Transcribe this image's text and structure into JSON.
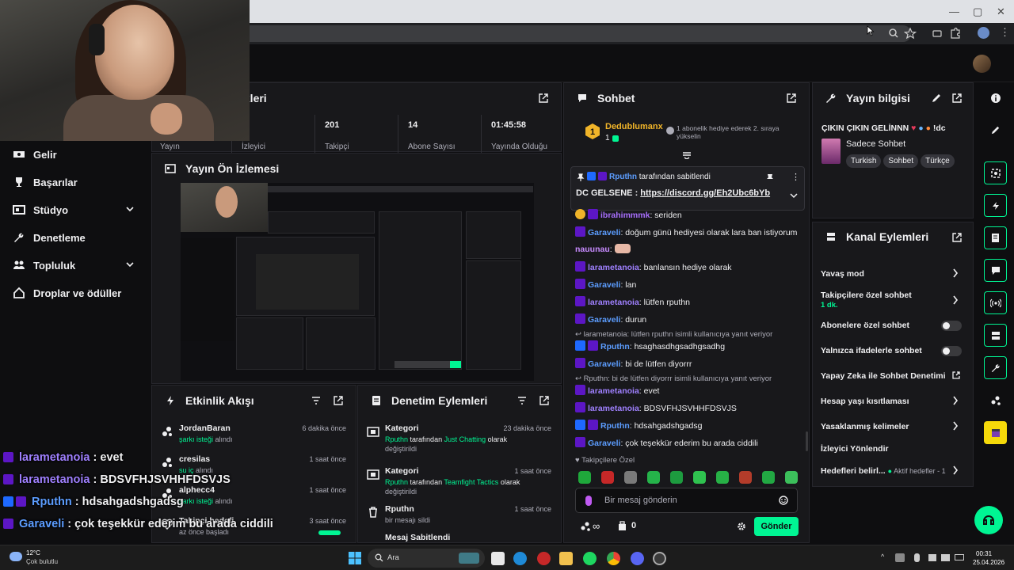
{
  "chat": {
    "title": "Sohbet",
    "top_user": "Dedublumanx",
    "top_user_count": "1",
    "top_note": "1 abonelik hediye ederek 2. sıraya yükselin",
    "pinned_by_user": "Rputhn",
    "pinned_by_suffix": "tarafından sabitlendi",
    "pinned_text": "DC GELSENE :",
    "pinned_link": "https://discord.gg/Eh2Ubc6bYb",
    "messages": [
      {
        "user": "ibrahimmmk",
        "text": "seriden",
        "color": "#a970ff",
        "badge": "gold"
      },
      {
        "user": "Garaveli",
        "text": "doğum günü hediyesi olarak lara ban istiyorum",
        "color": "#5c9dff",
        "badge": "star"
      },
      {
        "user": "nauunau",
        "text": "",
        "color": "#c88bff",
        "badge": "none"
      },
      {
        "user": "larametanoia",
        "text": "banlansın hediye olarak",
        "color": "#9f80ff",
        "badge": "star"
      },
      {
        "user": "Garaveli",
        "text": "lan",
        "color": "#5c9dff",
        "badge": "star"
      },
      {
        "user": "larametanoia",
        "text": "lütfen rputhn",
        "color": "#9f80ff",
        "badge": "star"
      },
      {
        "user": "Garaveli",
        "text": "durun",
        "color": "#5c9dff",
        "badge": "star"
      },
      {
        "user": "Rputhn",
        "text": "hsaghasdhgsadhgsadhg",
        "color": "#5c9dff",
        "badge": "blue"
      },
      {
        "user": "Garaveli",
        "text": "bi de lütfen diyorrr",
        "color": "#5c9dff",
        "badge": "star"
      },
      {
        "user": "larametanoia",
        "text": "evet",
        "color": "#9f80ff",
        "badge": "star"
      },
      {
        "user": "larametanoia",
        "text": "BDSVFHJSVHHFDSVJS",
        "color": "#9f80ff",
        "badge": "star"
      },
      {
        "user": "Rputhn",
        "text": "hdsahgadshgadsg",
        "color": "#5c9dff",
        "badge": "blue"
      },
      {
        "user": "Garaveli",
        "text": "çok teşekkür ederim bu arada ciddili",
        "color": "#5c9dff",
        "badge": "star"
      }
    ],
    "reply1": "↩ larametanoia: lütfen rputhn isimli kullanıcıya yanıt veriyor",
    "reply2": "↩ Rputhn: bi de lütfen diyorrr isimli kullanıcıya yanıt veriyor",
    "followers_only": "Takipçilere Özel",
    "input_placeholder": "Bir mesaj gönderin",
    "points": "0",
    "send_label": "Gönder"
  },
  "stats": {
    "title_partial": "ikleri",
    "values": [
      "201",
      "14",
      "01:45:58"
    ],
    "labels": [
      "Yayın",
      "İzleyici",
      "Takipçi",
      "Abone Sayısı",
      "Yayında Olduğu"
    ]
  },
  "preview": {
    "title": "Yayın Ön İzlemesi"
  },
  "nav": {
    "items": [
      {
        "label": "Gelir",
        "icon": "dollar-icon"
      },
      {
        "label": "Başarılar",
        "icon": "trophy-icon"
      },
      {
        "label": "Stüdyo",
        "icon": "studio-icon"
      },
      {
        "label": "Denetleme",
        "icon": "wrench-icon"
      },
      {
        "label": "Topluluk",
        "icon": "community-icon"
      },
      {
        "label": "Droplar ve ödüller",
        "icon": "drops-icon"
      }
    ]
  },
  "activity": {
    "title": "Etkinlik Akışı",
    "items": [
      {
        "name": "JordanBaran",
        "sub_hl": "şarkı isteği",
        "sub": "alındı",
        "time": "6 dakika önce"
      },
      {
        "name": "cresilas",
        "sub_hl": "su iç",
        "sub": "alındı",
        "time": "1 saat önce"
      },
      {
        "name": "alphecc4",
        "sub_hl": "şarkı isteği",
        "sub": "alındı",
        "time": "1 saat önce"
      },
      {
        "name": "Takipçi hedefi",
        "sub_hl": "",
        "sub": "az önce başladı",
        "time": "3 saat önce"
      }
    ]
  },
  "modactions": {
    "title": "Denetim Eylemleri",
    "items": [
      {
        "title": "Kategori",
        "user": "Rputhn",
        "mid": "tarafından",
        "hl": "Just Chatting",
        "rest": "olarak",
        "end": "değiştirildi",
        "time": "23 dakika önce"
      },
      {
        "title": "Kategori",
        "user": "Rputhn",
        "mid": "tarafından",
        "hl": "Teamfight Tactics",
        "rest": "olarak",
        "end": "değiştirildi",
        "time": "1 saat önce"
      },
      {
        "title": "Rputhn",
        "user": "",
        "mid": "",
        "hl": "",
        "rest": "bir mesajı sildi",
        "end": "",
        "time": "1 saat önce"
      },
      {
        "title": "Mesaj Sabitlendi",
        "user": "",
        "mid": "",
        "hl": "",
        "rest": "",
        "end": "",
        "time": ""
      }
    ]
  },
  "info": {
    "title": "Yayın bilgisi",
    "stream_title": "ÇIKIN ÇIKIN GELİNNN",
    "stream_title_suffix": "!dc",
    "category": "Sadece Sohbet",
    "tags": [
      "Turkish",
      "Sohbet",
      "Türkçe"
    ]
  },
  "channel_actions": {
    "title": "Kanal Eylemleri",
    "rows": [
      {
        "label": "Yavaş mod",
        "type": "chevron"
      },
      {
        "label": "Takipçilere özel sohbet",
        "sub": "1 dk.",
        "type": "chevron"
      },
      {
        "label": "Abonelere özel sohbet",
        "type": "toggle"
      },
      {
        "label": "Yalnızca ifadelerle sohbet",
        "type": "toggle"
      },
      {
        "label": "Yapay Zeka ile Sohbet Denetimi",
        "type": "external"
      },
      {
        "label": "Hesap yaşı kısıtlaması",
        "type": "chevron"
      },
      {
        "label": "Yasaklanmış kelimeler",
        "type": "chevron"
      },
      {
        "label": "İzleyici Yönlendir",
        "type": "none"
      },
      {
        "label": "Hedefleri belirl...",
        "status": "Aktif hedefler - 1",
        "type": "chevron"
      }
    ]
  },
  "overlay": {
    "lines": [
      {
        "user": "larametanoia",
        "text": " : evet",
        "color": "#9f80ff",
        "badge": "star"
      },
      {
        "user": "larametanoia",
        "text": " : BDSVFHJSVHHFDSVJS",
        "color": "#9f80ff",
        "badge": "star"
      },
      {
        "user": "Rputhn",
        "text": " : hdsahgadshgadsg",
        "color": "#5c9dff",
        "badge": "blue"
      },
      {
        "user": "Garaveli",
        "text": " : çok teşekkür ederim bu arada ciddili",
        "color": "#5c9dff",
        "badge": "star"
      }
    ]
  },
  "taskbar": {
    "weather_temp": "12°C",
    "weather_desc": "Çok bulutlu",
    "search": "Ara",
    "time": "00:31",
    "date": "25.04.2026"
  },
  "colors": {
    "accent": "#00f593",
    "purple": "#9147ff",
    "bg": "#0e0e10",
    "panel": "#18181b"
  }
}
